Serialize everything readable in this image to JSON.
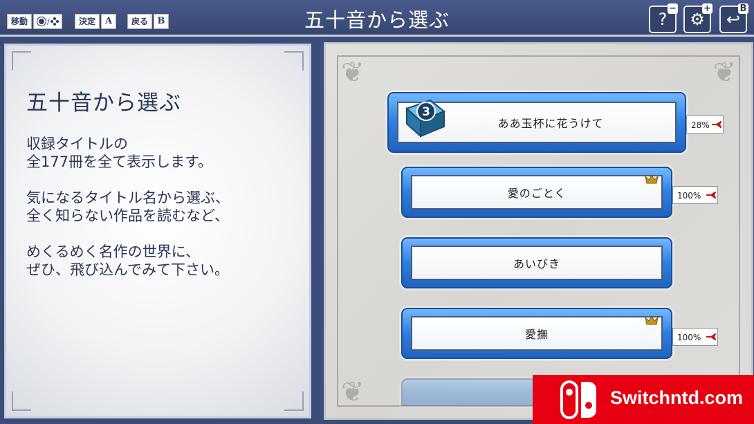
{
  "header": {
    "title": "五十音から選ぶ",
    "hints": {
      "move_label": "移動",
      "stick_separator": "/",
      "confirm_label": "決定",
      "confirm_key": "A",
      "back_label": "戻る",
      "back_key": "B"
    },
    "buttons": {
      "help_glyph": "?",
      "help_key": "−",
      "settings_glyph": "⚙",
      "settings_key": "+",
      "back_glyph": "↩",
      "back_key": "B"
    }
  },
  "info": {
    "heading": "五十音から選ぶ",
    "paragraphs": [
      "収録タイトルの\n全177冊を全て表示します。",
      "気になるタイトル名から選ぶ、\n全く知らない作品を読むなど、",
      "めくるめく名作の世界に、\nぜひ、飛び込んでみて下さい。"
    ]
  },
  "list": {
    "items": [
      {
        "title": "ああ玉杯に花うけて",
        "progress": "28%",
        "progress_value": 28,
        "crown": false,
        "volume": "3",
        "selected": true
      },
      {
        "title": "愛のごとく",
        "progress": "100%",
        "progress_value": 100,
        "crown": true,
        "selected": false
      },
      {
        "title": "あいびき",
        "progress": "",
        "crown": false,
        "selected": false
      },
      {
        "title": "愛撫",
        "progress": "100%",
        "progress_value": 100,
        "crown": true,
        "selected": false
      }
    ]
  },
  "watermark": {
    "text": "Switchntd.com"
  },
  "colors": {
    "frame": "#3c4c79",
    "item_blue": "#2d7fe0",
    "text_dark": "#2a3558",
    "watermark_red": "#e60012",
    "crown_gold": "#c8961c"
  }
}
